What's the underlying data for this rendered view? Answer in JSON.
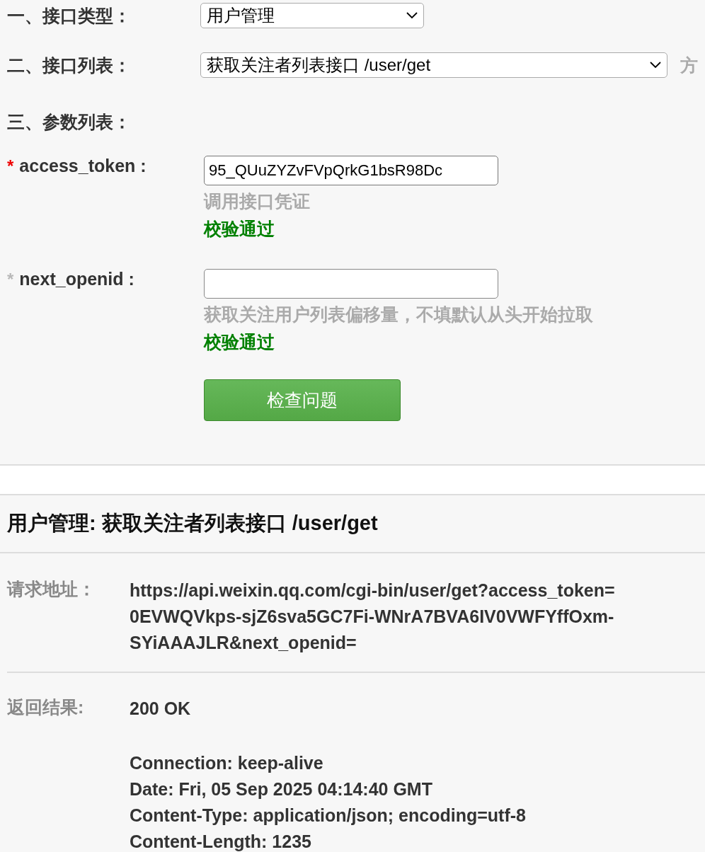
{
  "sections": [
    {
      "label": "一、接口类型：",
      "select": "用户管理"
    },
    {
      "label": "二、接口列表：",
      "select": "获取关注者列表接口 /user/get",
      "trailing": "方"
    },
    {
      "label": "三、参数列表："
    }
  ],
  "params": [
    {
      "marker": "*",
      "required": true,
      "name": "access_token :",
      "value": "95_QUuZYZvFVpQrkG1bsR98Dc",
      "hint": "调用接口凭证",
      "status": "校验通过"
    },
    {
      "marker": "*",
      "required": false,
      "name": "next_openid :",
      "hint": "获取关注用户列表偏移量，不填默认从头开始拉取",
      "status": "校验通过"
    }
  ],
  "button": "检查问题",
  "result": {
    "title": "用户管理: 获取关注者列表接口 /user/get",
    "request": {
      "label": "请求地址：",
      "lines": [
        "https://api.weixin.qq.com/cgi-bin/user/get?access_token=",
        "0EVWQVkps-sjZ6sva5GC7Fi-WNrA7BVA6IV0VWFYffOxm-",
        "SYiAAAJLR&next_openid="
      ]
    },
    "response": {
      "label": "返回结果:",
      "status": "200 OK",
      "headers": [
        "Connection: keep-alive",
        "Date: Fri, 05 Sep 2025 04:14:40 GMT",
        "Content-Type: application/json; encoding=utf-8",
        "Content-Length: 1235"
      ]
    }
  }
}
